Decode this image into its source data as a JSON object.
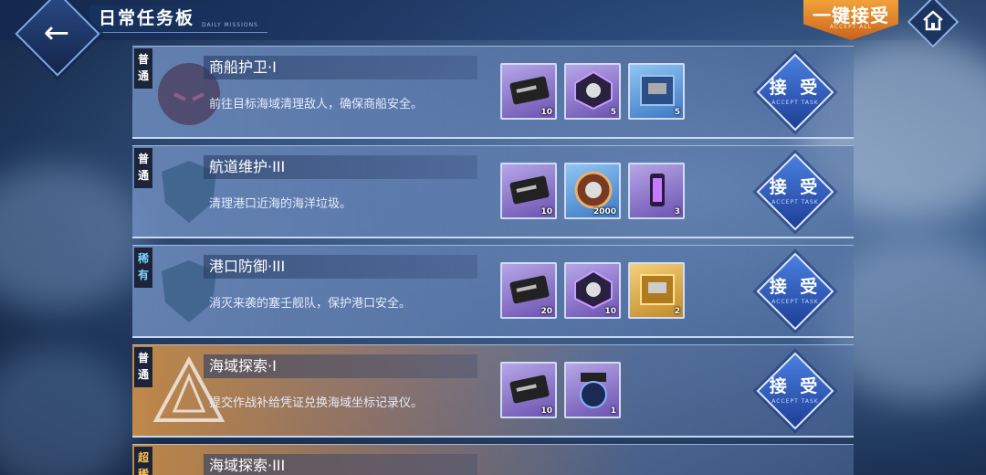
{
  "header": {
    "title": "日常任务板",
    "subtitle": "DAILY MISSIONS",
    "accept_all_label": "一键接受",
    "accept_all_sub": "ACCEPT ALL",
    "back_icon": "arrow-left-icon",
    "home_icon": "home-icon"
  },
  "accept_button": {
    "label": "接 受",
    "sub": "ACCEPT TASK"
  },
  "tasks": [
    {
      "rarity": "普通",
      "title": "商船护卫·I",
      "desc": "前往目标海域清理敌人，确保商船安全。",
      "rewards": [
        {
          "icon": "meta-card-icon",
          "count": "10",
          "color": "purple"
        },
        {
          "icon": "cube-core-icon",
          "count": "5",
          "color": "purple"
        },
        {
          "icon": "supply-box-icon",
          "count": "5",
          "color": "blue"
        }
      ]
    },
    {
      "rarity": "普通",
      "title": "航道维护·III",
      "desc": "清理港口近海的海洋垃圾。",
      "rewards": [
        {
          "icon": "meta-card-icon",
          "count": "10",
          "color": "purple"
        },
        {
          "icon": "coin-icon",
          "count": "2000",
          "color": "blue"
        },
        {
          "icon": "energy-canister-icon",
          "count": "3",
          "color": "purple"
        }
      ]
    },
    {
      "rarity": "稀有",
      "title": "港口防御·III",
      "desc": "消灭来袭的塞壬舰队，保护港口安全。",
      "rewards": [
        {
          "icon": "meta-card-icon",
          "count": "20",
          "color": "purple"
        },
        {
          "icon": "cube-core-icon",
          "count": "10",
          "color": "purple"
        },
        {
          "icon": "supply-box-icon",
          "count": "2",
          "color": "gold"
        }
      ]
    },
    {
      "rarity": "普通",
      "title": "海域探索·I",
      "desc": "提交作战补给凭证兑换海域坐标记录仪。",
      "rewards": [
        {
          "icon": "meta-card-icon",
          "count": "10",
          "color": "purple"
        },
        {
          "icon": "coordinate-recorder-icon",
          "count": "1",
          "color": "purple"
        }
      ]
    },
    {
      "rarity": "超稀",
      "title": "海域探索·III"
    }
  ]
}
